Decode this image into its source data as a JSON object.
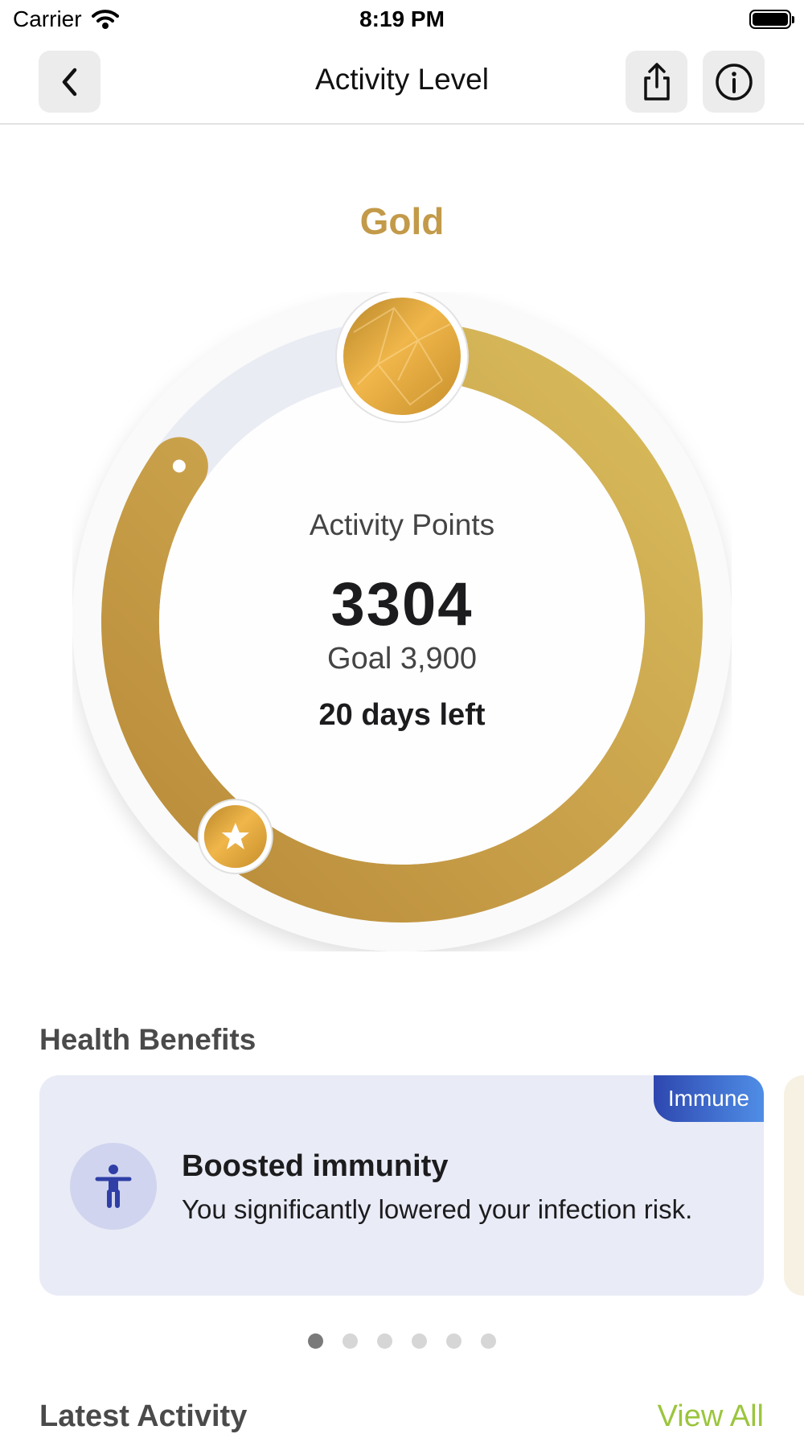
{
  "status_bar": {
    "carrier": "Carrier",
    "time": "8:19 PM"
  },
  "nav": {
    "title": "Activity Level",
    "back_icon": "chevron-left-icon",
    "share_icon": "share-icon",
    "info_icon": "info-icon"
  },
  "level": {
    "name": "Gold",
    "color": "#c39a49"
  },
  "ring": {
    "label": "Activity Points",
    "points": "3304",
    "goal_text": "Goal 3,900",
    "days_left": "20 days left",
    "progress": 0.847
  },
  "health_benefits": {
    "title": "Health Benefits",
    "cards": [
      {
        "tag": "Immune",
        "icon": "accessibility-icon",
        "title": "Boosted immunity",
        "description": "You significantly lowered your infection risk."
      }
    ],
    "page_count": 6,
    "active_page": 0
  },
  "latest_activity": {
    "title": "Latest Activity",
    "view_all": "View All"
  }
}
